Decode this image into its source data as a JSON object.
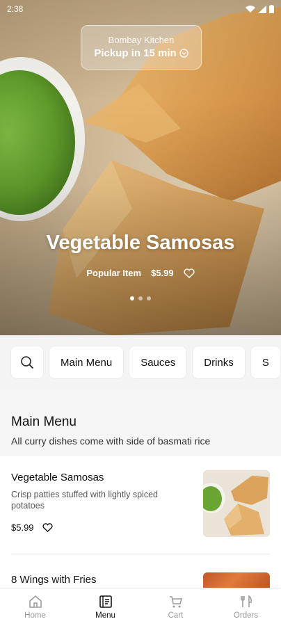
{
  "status_bar": {
    "time": "2:38"
  },
  "restaurant": {
    "name": "Bombay Kitchen",
    "pickup": "Pickup in 15 min"
  },
  "hero": {
    "title": "Vegetable Samosas",
    "tag": "Popular Item",
    "price": "$5.99",
    "slide_count": 3,
    "active_slide": 1
  },
  "categories": {
    "items": [
      "Main Menu",
      "Sauces",
      "Drinks",
      "S"
    ]
  },
  "section": {
    "title": "Main Menu",
    "subtitle": "All curry dishes come with side of basmati rice"
  },
  "menu_items": [
    {
      "name": "Vegetable Samosas",
      "description": "Crisp patties stuffed with lightly spiced potatoes",
      "price": "$5.99"
    },
    {
      "name": "8 Wings with Fries"
    }
  ],
  "bottom_nav": {
    "items": [
      {
        "label": "Home",
        "icon": "home-icon"
      },
      {
        "label": "Menu",
        "icon": "menu-book-icon",
        "active": true
      },
      {
        "label": "Cart",
        "icon": "cart-icon"
      },
      {
        "label": "Orders",
        "icon": "utensils-icon"
      }
    ]
  }
}
